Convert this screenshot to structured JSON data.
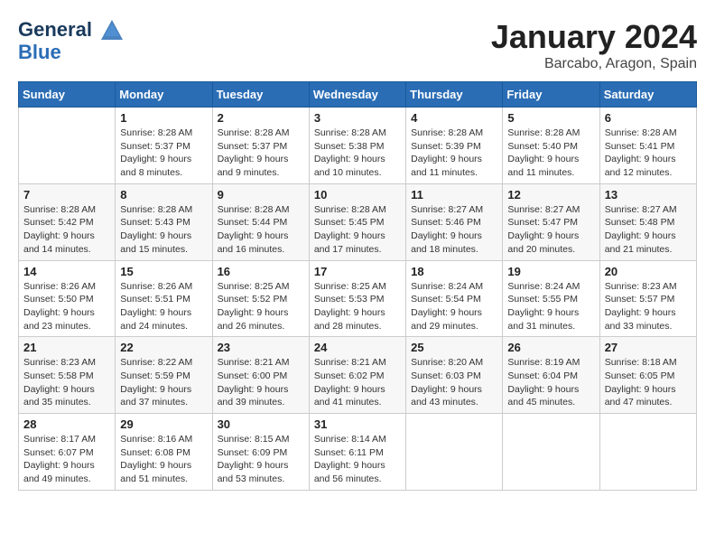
{
  "header": {
    "logo_line1": "General",
    "logo_line2": "Blue",
    "month": "January 2024",
    "location": "Barcabo, Aragon, Spain"
  },
  "weekdays": [
    "Sunday",
    "Monday",
    "Tuesday",
    "Wednesday",
    "Thursday",
    "Friday",
    "Saturday"
  ],
  "weeks": [
    [
      {
        "day": "",
        "sunrise": "",
        "sunset": "",
        "daylight": ""
      },
      {
        "day": "1",
        "sunrise": "Sunrise: 8:28 AM",
        "sunset": "Sunset: 5:37 PM",
        "daylight": "Daylight: 9 hours and 8 minutes."
      },
      {
        "day": "2",
        "sunrise": "Sunrise: 8:28 AM",
        "sunset": "Sunset: 5:37 PM",
        "daylight": "Daylight: 9 hours and 9 minutes."
      },
      {
        "day": "3",
        "sunrise": "Sunrise: 8:28 AM",
        "sunset": "Sunset: 5:38 PM",
        "daylight": "Daylight: 9 hours and 10 minutes."
      },
      {
        "day": "4",
        "sunrise": "Sunrise: 8:28 AM",
        "sunset": "Sunset: 5:39 PM",
        "daylight": "Daylight: 9 hours and 11 minutes."
      },
      {
        "day": "5",
        "sunrise": "Sunrise: 8:28 AM",
        "sunset": "Sunset: 5:40 PM",
        "daylight": "Daylight: 9 hours and 11 minutes."
      },
      {
        "day": "6",
        "sunrise": "Sunrise: 8:28 AM",
        "sunset": "Sunset: 5:41 PM",
        "daylight": "Daylight: 9 hours and 12 minutes."
      }
    ],
    [
      {
        "day": "7",
        "sunrise": "Sunrise: 8:28 AM",
        "sunset": "Sunset: 5:42 PM",
        "daylight": "Daylight: 9 hours and 14 minutes."
      },
      {
        "day": "8",
        "sunrise": "Sunrise: 8:28 AM",
        "sunset": "Sunset: 5:43 PM",
        "daylight": "Daylight: 9 hours and 15 minutes."
      },
      {
        "day": "9",
        "sunrise": "Sunrise: 8:28 AM",
        "sunset": "Sunset: 5:44 PM",
        "daylight": "Daylight: 9 hours and 16 minutes."
      },
      {
        "day": "10",
        "sunrise": "Sunrise: 8:28 AM",
        "sunset": "Sunset: 5:45 PM",
        "daylight": "Daylight: 9 hours and 17 minutes."
      },
      {
        "day": "11",
        "sunrise": "Sunrise: 8:27 AM",
        "sunset": "Sunset: 5:46 PM",
        "daylight": "Daylight: 9 hours and 18 minutes."
      },
      {
        "day": "12",
        "sunrise": "Sunrise: 8:27 AM",
        "sunset": "Sunset: 5:47 PM",
        "daylight": "Daylight: 9 hours and 20 minutes."
      },
      {
        "day": "13",
        "sunrise": "Sunrise: 8:27 AM",
        "sunset": "Sunset: 5:48 PM",
        "daylight": "Daylight: 9 hours and 21 minutes."
      }
    ],
    [
      {
        "day": "14",
        "sunrise": "Sunrise: 8:26 AM",
        "sunset": "Sunset: 5:50 PM",
        "daylight": "Daylight: 9 hours and 23 minutes."
      },
      {
        "day": "15",
        "sunrise": "Sunrise: 8:26 AM",
        "sunset": "Sunset: 5:51 PM",
        "daylight": "Daylight: 9 hours and 24 minutes."
      },
      {
        "day": "16",
        "sunrise": "Sunrise: 8:25 AM",
        "sunset": "Sunset: 5:52 PM",
        "daylight": "Daylight: 9 hours and 26 minutes."
      },
      {
        "day": "17",
        "sunrise": "Sunrise: 8:25 AM",
        "sunset": "Sunset: 5:53 PM",
        "daylight": "Daylight: 9 hours and 28 minutes."
      },
      {
        "day": "18",
        "sunrise": "Sunrise: 8:24 AM",
        "sunset": "Sunset: 5:54 PM",
        "daylight": "Daylight: 9 hours and 29 minutes."
      },
      {
        "day": "19",
        "sunrise": "Sunrise: 8:24 AM",
        "sunset": "Sunset: 5:55 PM",
        "daylight": "Daylight: 9 hours and 31 minutes."
      },
      {
        "day": "20",
        "sunrise": "Sunrise: 8:23 AM",
        "sunset": "Sunset: 5:57 PM",
        "daylight": "Daylight: 9 hours and 33 minutes."
      }
    ],
    [
      {
        "day": "21",
        "sunrise": "Sunrise: 8:23 AM",
        "sunset": "Sunset: 5:58 PM",
        "daylight": "Daylight: 9 hours and 35 minutes."
      },
      {
        "day": "22",
        "sunrise": "Sunrise: 8:22 AM",
        "sunset": "Sunset: 5:59 PM",
        "daylight": "Daylight: 9 hours and 37 minutes."
      },
      {
        "day": "23",
        "sunrise": "Sunrise: 8:21 AM",
        "sunset": "Sunset: 6:00 PM",
        "daylight": "Daylight: 9 hours and 39 minutes."
      },
      {
        "day": "24",
        "sunrise": "Sunrise: 8:21 AM",
        "sunset": "Sunset: 6:02 PM",
        "daylight": "Daylight: 9 hours and 41 minutes."
      },
      {
        "day": "25",
        "sunrise": "Sunrise: 8:20 AM",
        "sunset": "Sunset: 6:03 PM",
        "daylight": "Daylight: 9 hours and 43 minutes."
      },
      {
        "day": "26",
        "sunrise": "Sunrise: 8:19 AM",
        "sunset": "Sunset: 6:04 PM",
        "daylight": "Daylight: 9 hours and 45 minutes."
      },
      {
        "day": "27",
        "sunrise": "Sunrise: 8:18 AM",
        "sunset": "Sunset: 6:05 PM",
        "daylight": "Daylight: 9 hours and 47 minutes."
      }
    ],
    [
      {
        "day": "28",
        "sunrise": "Sunrise: 8:17 AM",
        "sunset": "Sunset: 6:07 PM",
        "daylight": "Daylight: 9 hours and 49 minutes."
      },
      {
        "day": "29",
        "sunrise": "Sunrise: 8:16 AM",
        "sunset": "Sunset: 6:08 PM",
        "daylight": "Daylight: 9 hours and 51 minutes."
      },
      {
        "day": "30",
        "sunrise": "Sunrise: 8:15 AM",
        "sunset": "Sunset: 6:09 PM",
        "daylight": "Daylight: 9 hours and 53 minutes."
      },
      {
        "day": "31",
        "sunrise": "Sunrise: 8:14 AM",
        "sunset": "Sunset: 6:11 PM",
        "daylight": "Daylight: 9 hours and 56 minutes."
      },
      {
        "day": "",
        "sunrise": "",
        "sunset": "",
        "daylight": ""
      },
      {
        "day": "",
        "sunrise": "",
        "sunset": "",
        "daylight": ""
      },
      {
        "day": "",
        "sunrise": "",
        "sunset": "",
        "daylight": ""
      }
    ]
  ]
}
